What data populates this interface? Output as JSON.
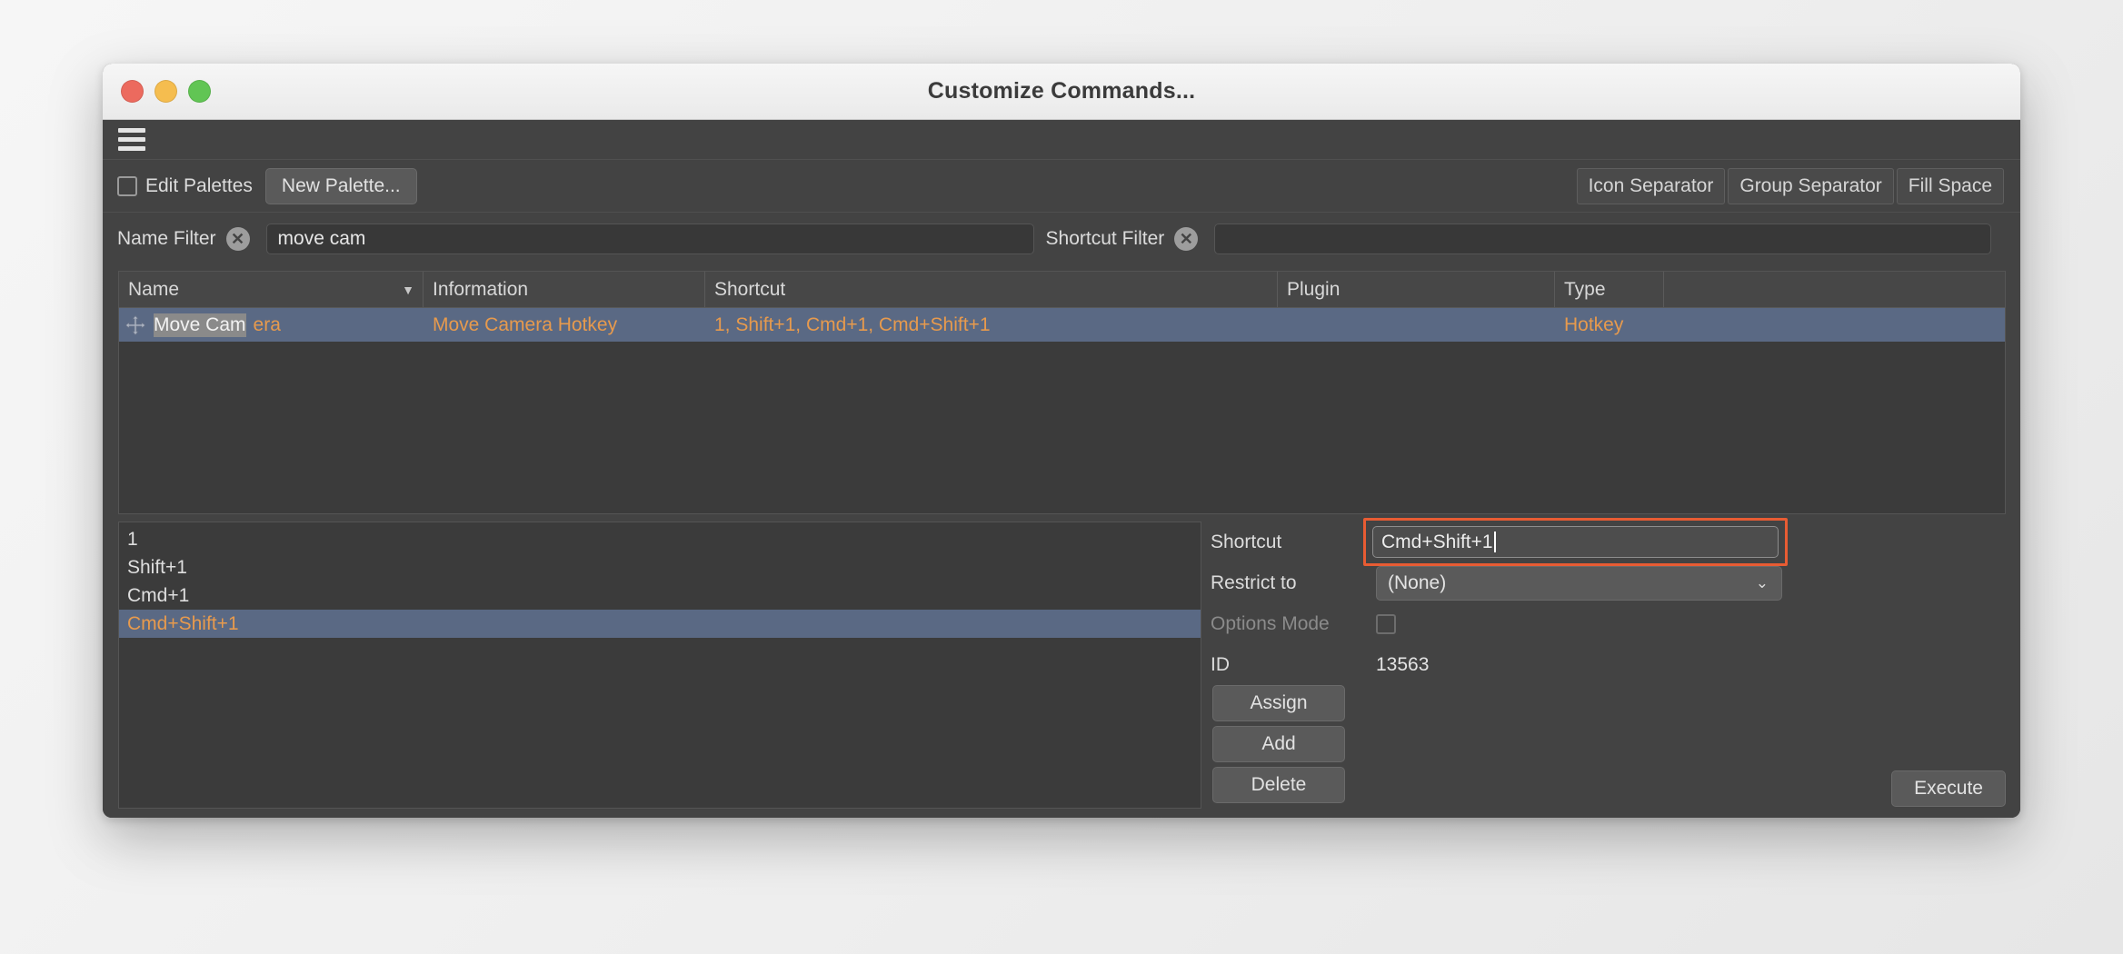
{
  "window": {
    "title": "Customize Commands...",
    "traffic_lights": [
      {
        "name": "close",
        "color": "#ec6a5e"
      },
      {
        "name": "minimize",
        "color": "#f5bd4f"
      },
      {
        "name": "maximize",
        "color": "#61c554"
      }
    ]
  },
  "menubar": {
    "icon": "hamburger-menu-icon"
  },
  "toolbar": {
    "edit_palettes_label": "Edit Palettes",
    "edit_palettes_checked": false,
    "new_palette_label": "New Palette...",
    "icon_separator_label": "Icon Separator",
    "group_separator_label": "Group Separator",
    "fill_space_label": "Fill Space"
  },
  "filters": {
    "name_filter_label": "Name Filter",
    "name_filter_value": "move cam",
    "name_filter_placeholder": "",
    "name_filter_clear_icon": "clear-circle-icon",
    "shortcut_filter_label": "Shortcut Filter",
    "shortcut_filter_value": "",
    "shortcut_filter_placeholder": "",
    "shortcut_filter_clear_icon": "clear-circle-icon"
  },
  "table": {
    "columns": [
      {
        "key": "name",
        "label": "Name",
        "sorted": true,
        "sort_arrow": "▼"
      },
      {
        "key": "information",
        "label": "Information"
      },
      {
        "key": "shortcut",
        "label": "Shortcut"
      },
      {
        "key": "plugin",
        "label": "Plugin"
      },
      {
        "key": "type",
        "label": "Type"
      }
    ],
    "rows": [
      {
        "icon": "move-camera-icon",
        "name_match": "Move Cam",
        "name_rest": "era",
        "name": "Move Camera",
        "information": "Move Camera Hotkey",
        "shortcut": "1, Shift+1, Cmd+1, Cmd+Shift+1",
        "plugin": "",
        "type": "Hotkey",
        "selected": true
      }
    ]
  },
  "shortcut_list": {
    "items": [
      {
        "label": "1",
        "selected": false
      },
      {
        "label": "Shift+1",
        "selected": false
      },
      {
        "label": "Cmd+1",
        "selected": false
      },
      {
        "label": "Cmd+Shift+1",
        "selected": true
      }
    ]
  },
  "detail": {
    "shortcut_label": "Shortcut",
    "shortcut_value": "Cmd+Shift+1",
    "shortcut_focused": true,
    "restrict_label": "Restrict to",
    "restrict_value": "(None)",
    "restrict_options": [
      "(None)"
    ],
    "restrict_chevron_icon": "chevron-down-icon",
    "options_mode_label": "Options Mode",
    "options_mode_checked": false,
    "options_mode_disabled": true,
    "id_label": "ID",
    "id_value": "13563",
    "assign_label": "Assign",
    "add_label": "Add",
    "delete_label": "Delete",
    "execute_label": "Execute"
  },
  "colors": {
    "accent_orange": "#e79a4d",
    "selection_blue": "#5a6984",
    "focus_outline": "#e85c33",
    "panel_bg": "#434343",
    "field_bg": "#383838"
  }
}
